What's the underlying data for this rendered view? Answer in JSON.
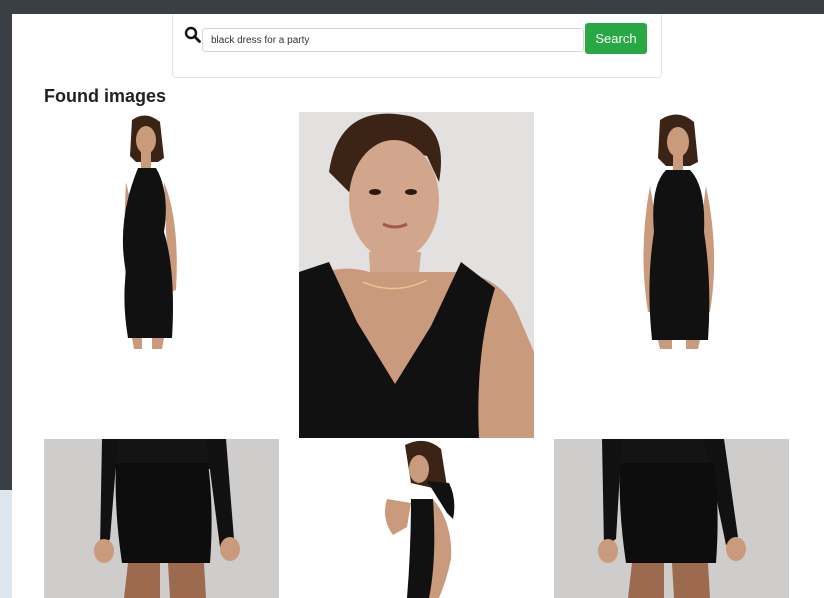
{
  "search": {
    "value": "black dress for a party",
    "button_label": "Search"
  },
  "results": {
    "title": "Found images",
    "images": [
      {
        "name": "halter-dress-side-view"
      },
      {
        "name": "v-neck-dress-closeup"
      },
      {
        "name": "halter-dress-front-view"
      },
      {
        "name": "long-sleeve-dress-left"
      },
      {
        "name": "backless-halter-dress"
      },
      {
        "name": "long-sleeve-dress-right"
      }
    ]
  },
  "colors": {
    "accent": "#28a745",
    "dress": "#111111",
    "skin": "#c99a7c",
    "hair": "#3b2416",
    "backdrop": "#d8d6d3"
  }
}
